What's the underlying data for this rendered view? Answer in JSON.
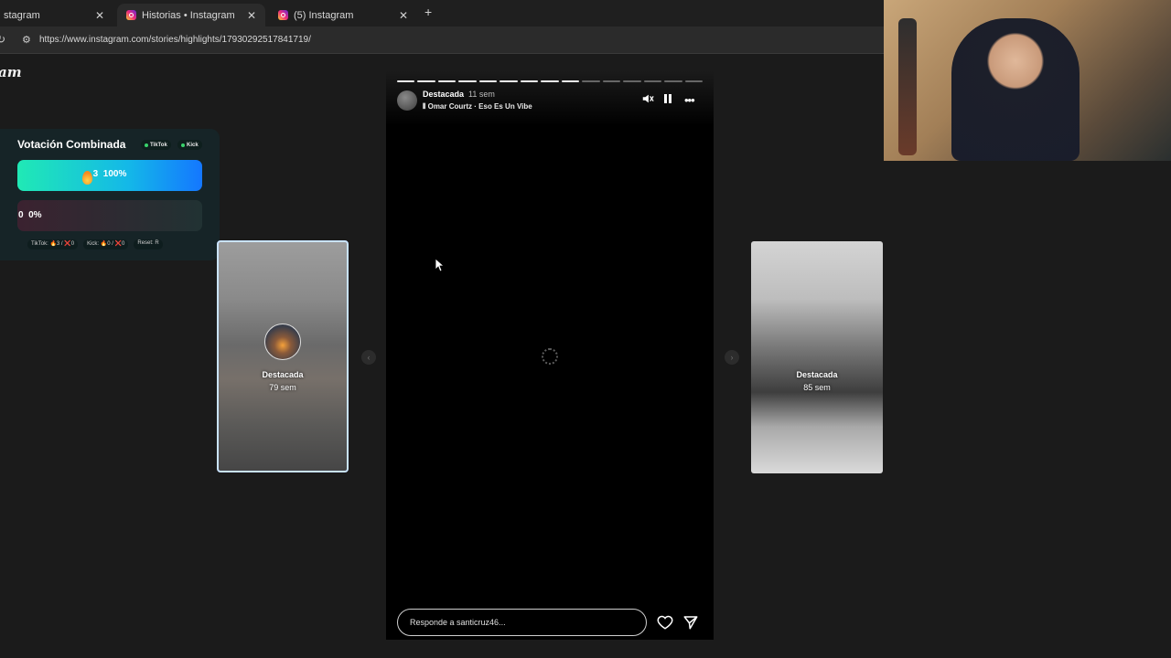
{
  "browser": {
    "tabs": [
      {
        "title": "stagram",
        "active": false
      },
      {
        "title": "Historias • Instagram",
        "active": true
      },
      {
        "title": "(5) Instagram",
        "active": false
      }
    ],
    "url": "https://www.instagram.com/stories/highlights/17930292517841719/"
  },
  "instagram": {
    "logo_text": "am"
  },
  "vote_widget": {
    "title": "Votación Combinada",
    "badges": [
      "TikTok",
      "Kick"
    ],
    "option1": {
      "count": "3",
      "percent": "100%"
    },
    "option2": {
      "count": "0",
      "percent": "0%"
    },
    "footer": [
      "TikTok: 🔥3 / ❌0",
      "Kick: 🔥0 / ❌0",
      "Reset: R"
    ]
  },
  "story": {
    "user": "Destacada",
    "time": "11 sem",
    "music": "Omar Courtz · Eso Es Un Vibe",
    "segments_total": 15,
    "segments_done": 9,
    "reply_placeholder": "Responde a santicruz46..."
  },
  "previews": {
    "left": {
      "title": "Destacada",
      "time": "79 sem"
    },
    "right": {
      "title": "Destacada",
      "time": "85 sem"
    }
  },
  "colors": {
    "vote_bar": "#14b8e8",
    "story_bg": "#000000",
    "page_bg": "#1b1b1b"
  }
}
